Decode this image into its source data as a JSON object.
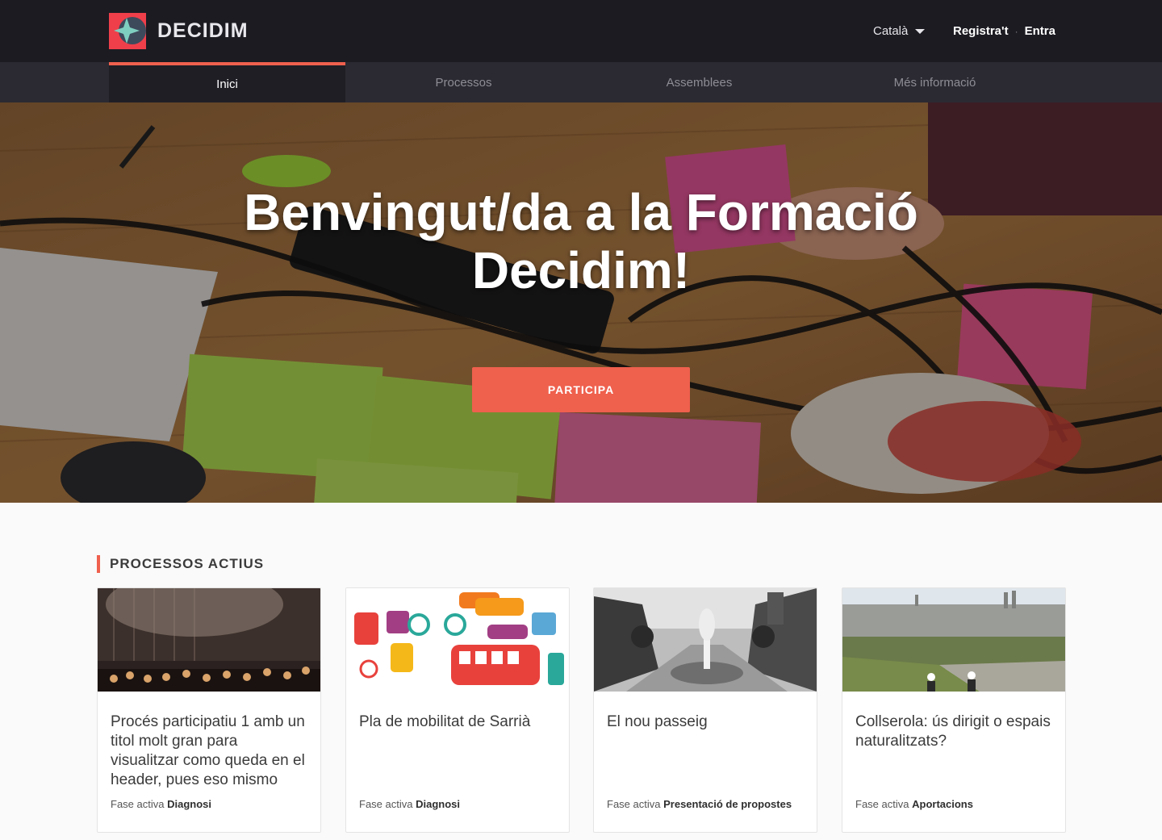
{
  "header": {
    "logo_text": "DECIDIM",
    "language": "Català",
    "register_label": "Registra't",
    "separator": "·",
    "login_label": "Entra"
  },
  "nav": {
    "items": [
      {
        "label": "Inici",
        "active": true
      },
      {
        "label": "Processos",
        "active": false
      },
      {
        "label": "Assemblees",
        "active": false
      },
      {
        "label": "Més informació",
        "active": false
      }
    ]
  },
  "hero": {
    "title": "Benvingut/da a la Formació Decidim!",
    "cta_label": "PARTICIPA"
  },
  "processes": {
    "section_title": "PROCESSOS ACTIUS",
    "phase_prefix": "Fase activa",
    "cards": [
      {
        "title": "Procés participatiu 1 amb un titol molt gran para visualitzar como queda en el header, pues eso mismo",
        "phase": "Diagnosi"
      },
      {
        "title": "Pla de mobilitat de Sarrià",
        "phase": "Diagnosi"
      },
      {
        "title": "El nou passeig",
        "phase": "Presentació de propostes"
      },
      {
        "title": "Collserola: ús dirigit o espais naturalitzats?",
        "phase": "Aportacions"
      }
    ]
  },
  "colors": {
    "accent": "#ef604d",
    "topbar": "#1c1b22",
    "navbar": "#2b2a32"
  }
}
